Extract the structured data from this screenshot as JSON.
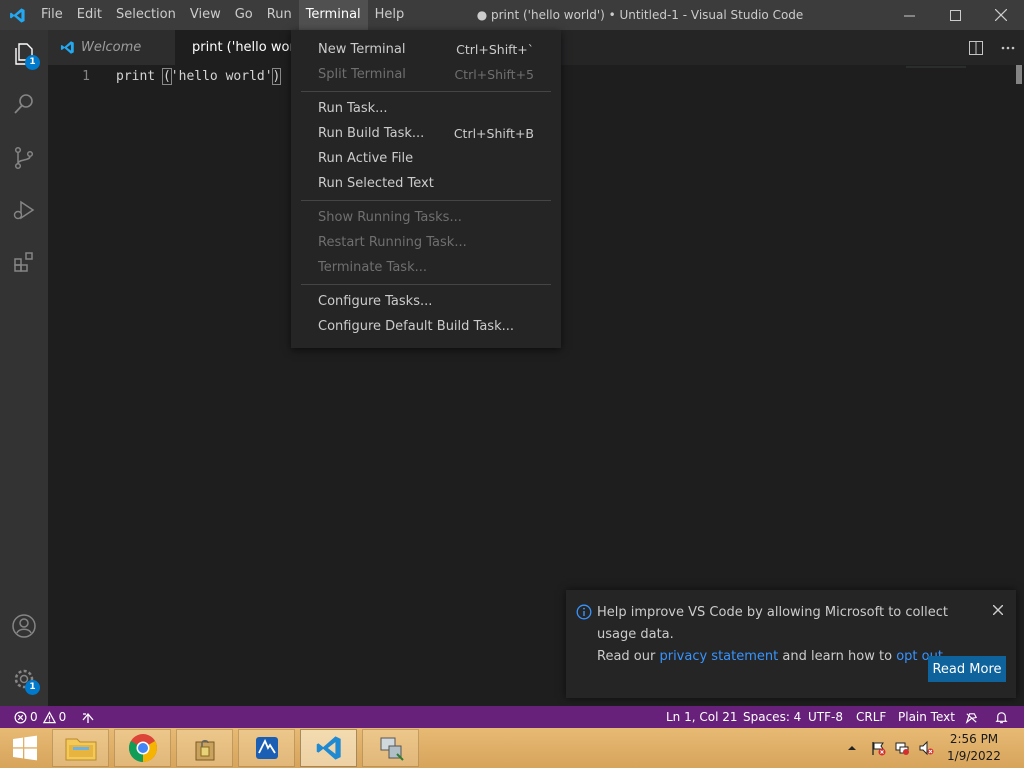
{
  "titlebar": {
    "menu": [
      "File",
      "Edit",
      "Selection",
      "View",
      "Go",
      "Run",
      "Terminal",
      "Help"
    ],
    "active_menu": "Terminal",
    "window_title": "● print ('hello world') • Untitled-1 - Visual Studio Code"
  },
  "activity": {
    "explorer_badge": "1",
    "settings_badge": "1"
  },
  "tabs": {
    "welcome": "Welcome",
    "active": "print ('hello world')"
  },
  "editor": {
    "line_number": "1",
    "code_before": "print ",
    "code_paren_open": "(",
    "code_string": "'hello world'",
    "code_paren_close": ")"
  },
  "terminal_menu": {
    "groups": [
      [
        {
          "label": "New Terminal",
          "key": "Ctrl+Shift+`",
          "disabled": false
        },
        {
          "label": "Split Terminal",
          "key": "Ctrl+Shift+5",
          "disabled": true
        }
      ],
      [
        {
          "label": "Run Task...",
          "key": "",
          "disabled": false
        },
        {
          "label": "Run Build Task...",
          "key": "Ctrl+Shift+B",
          "disabled": false
        },
        {
          "label": "Run Active File",
          "key": "",
          "disabled": false
        },
        {
          "label": "Run Selected Text",
          "key": "",
          "disabled": false
        }
      ],
      [
        {
          "label": "Show Running Tasks...",
          "key": "",
          "disabled": true
        },
        {
          "label": "Restart Running Task...",
          "key": "",
          "disabled": true
        },
        {
          "label": "Terminate Task...",
          "key": "",
          "disabled": true
        }
      ],
      [
        {
          "label": "Configure Tasks...",
          "key": "",
          "disabled": false
        },
        {
          "label": "Configure Default Build Task...",
          "key": "",
          "disabled": false
        }
      ]
    ]
  },
  "notification": {
    "line1": "Help improve VS Code by allowing Microsoft to collect usage data.",
    "line2_pre": "Read our ",
    "privacy_link": "privacy statement",
    "line2_mid": " and learn how to ",
    "opt_out_link": "opt out",
    "line2_post": ".",
    "button": "Read More"
  },
  "statusbar": {
    "errors": "0",
    "warnings": "0",
    "position": "Ln 1, Col 21",
    "spaces": "Spaces: 4",
    "encoding": "UTF-8",
    "eol": "CRLF",
    "language": "Plain Text"
  },
  "taskbar": {
    "time": "2:56 PM",
    "date": "1/9/2022"
  },
  "colors": {
    "statusbar": "#68217a",
    "accent": "#007acc",
    "button": "#0e639c",
    "link": "#3794ff"
  }
}
